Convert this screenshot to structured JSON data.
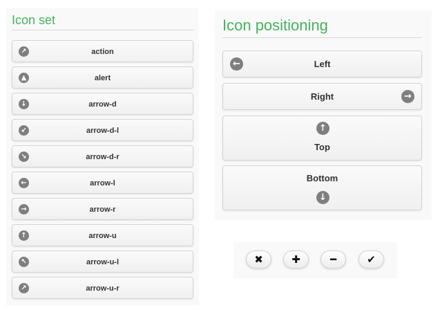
{
  "icon_set": {
    "title": "Icon set",
    "items": [
      {
        "label": "action",
        "icon": "action-icon",
        "glyph": "↗"
      },
      {
        "label": "alert",
        "icon": "alert-icon",
        "glyph": "▲"
      },
      {
        "label": "arrow-d",
        "icon": "arrow-d-icon",
        "glyph": "↓"
      },
      {
        "label": "arrow-d-l",
        "icon": "arrow-d-l-icon",
        "glyph": "↙"
      },
      {
        "label": "arrow-d-r",
        "icon": "arrow-d-r-icon",
        "glyph": "↘"
      },
      {
        "label": "arrow-l",
        "icon": "arrow-l-icon",
        "glyph": "←"
      },
      {
        "label": "arrow-r",
        "icon": "arrow-r-icon",
        "glyph": "→"
      },
      {
        "label": "arrow-u",
        "icon": "arrow-u-icon",
        "glyph": "↑"
      },
      {
        "label": "arrow-u-l",
        "icon": "arrow-u-l-icon",
        "glyph": "↖"
      },
      {
        "label": "arrow-u-r",
        "icon": "arrow-u-r-icon",
        "glyph": "↗"
      }
    ]
  },
  "icon_positioning": {
    "title": "Icon positioning",
    "buttons": [
      {
        "label": "Left",
        "icon": "arrow-l-icon",
        "glyph": "←"
      },
      {
        "label": "Right",
        "icon": "arrow-r-icon",
        "glyph": "→"
      },
      {
        "label": "Top",
        "icon": "arrow-u-icon",
        "glyph": "↑"
      },
      {
        "label": "Bottom",
        "icon": "arrow-d-icon",
        "glyph": "↓"
      }
    ]
  },
  "icon_only": {
    "buttons": [
      {
        "icon": "delete-icon",
        "glyph": "✖"
      },
      {
        "icon": "plus-icon",
        "glyph": "✚"
      },
      {
        "icon": "minus-icon",
        "glyph": "━"
      },
      {
        "icon": "check-icon",
        "glyph": "✔"
      }
    ]
  },
  "colors": {
    "heading": "#44b35d",
    "icon_background": "#7f7f7f",
    "button_text": "#333333"
  }
}
